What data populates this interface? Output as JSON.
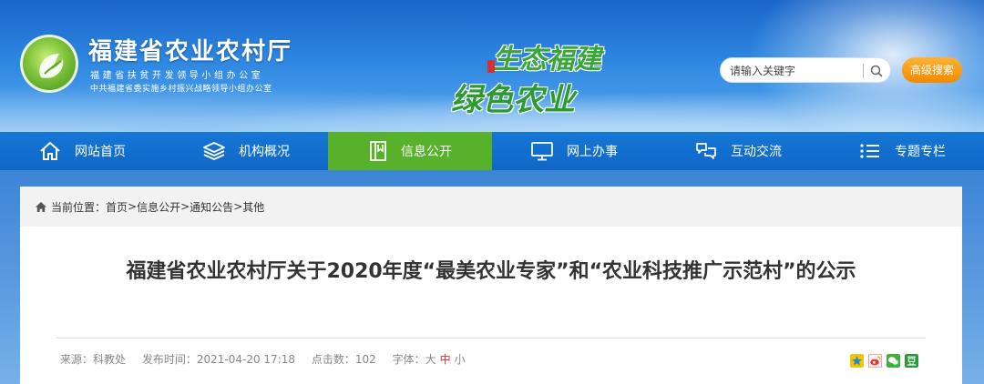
{
  "header": {
    "org_title": "福建省农业农村厅",
    "org_sub1": "福建省扶贫开发领导小组办公室",
    "org_sub2": "中共福建省委实施乡村振兴战略领导小组办公室",
    "slogan_line1": "生态福建",
    "slogan_line2": "绿色农业",
    "search_placeholder": "请输入关键字",
    "advanced_search_label": "高级搜索"
  },
  "nav": {
    "items": [
      {
        "label": "网站首页",
        "icon": "home-icon"
      },
      {
        "label": "机构概况",
        "icon": "layers-icon"
      },
      {
        "label": "信息公开",
        "icon": "book-icon",
        "active": true
      },
      {
        "label": "网上办事",
        "icon": "monitor-icon"
      },
      {
        "label": "互动交流",
        "icon": "chat-icon"
      },
      {
        "label": "专题专栏",
        "icon": "list-icon"
      }
    ]
  },
  "breadcrumb": {
    "prefix": "当前位置：",
    "items": [
      "首页",
      "信息公开",
      "通知公告",
      "其他"
    ],
    "separator": ">"
  },
  "article": {
    "title": "福建省农业农村厅关于2020年度“最美农业专家”和“农业科技推广示范村”的公示",
    "source": "来源：科教处",
    "published": "发布时间：2021-04-20 17:18",
    "clicks": "点击数：102",
    "font_label": "字体：",
    "font_sizes": [
      "大",
      "中",
      "小"
    ],
    "font_current": "中",
    "share_icons": [
      "qzone-icon",
      "weibo-icon",
      "wechat-icon",
      "douban-icon"
    ]
  },
  "colors": {
    "nav_active": "#58b12a",
    "nav_bg": "#1677d6",
    "accent_orange": "#f28a00",
    "font_current": "#d8312d"
  }
}
